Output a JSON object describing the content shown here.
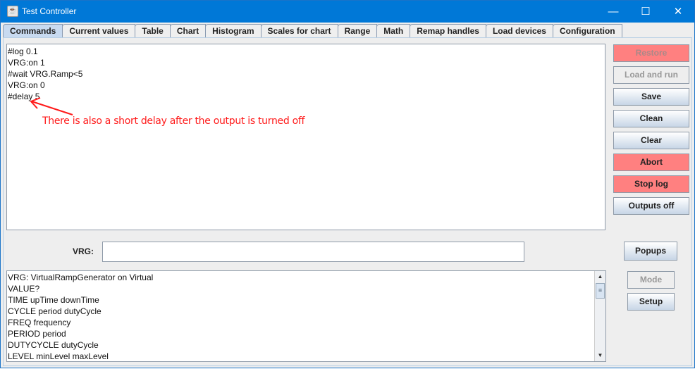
{
  "window": {
    "title": "Test Controller",
    "icon": "java-icon"
  },
  "tabs": [
    {
      "label": "Commands",
      "active": true
    },
    {
      "label": "Current values"
    },
    {
      "label": "Table"
    },
    {
      "label": "Chart"
    },
    {
      "label": "Histogram"
    },
    {
      "label": "Scales for chart"
    },
    {
      "label": "Range"
    },
    {
      "label": "Math"
    },
    {
      "label": "Remap handles"
    },
    {
      "label": "Load devices"
    },
    {
      "label": "Configuration"
    }
  ],
  "script_lines": [
    "#log 0.1",
    "VRG:on 1",
    "#wait VRG.Ramp<5",
    "VRG:on 0",
    "#delay 5"
  ],
  "annotation": {
    "text": "There is also a short delay after the output is turned off",
    "color": "#ff1a1a"
  },
  "buttons": {
    "restore": "Restore",
    "load_and_run": "Load and run",
    "save": "Save",
    "clean": "Clean",
    "clear": "Clear",
    "abort": "Abort",
    "stop_log": "Stop log",
    "outputs_off": "Outputs off",
    "popups": "Popups",
    "mode": "Mode",
    "setup": "Setup"
  },
  "device": {
    "label": "VRG:",
    "input_value": ""
  },
  "command_list": [
    "VRG: VirtualRampGenerator on Virtual",
    "VALUE?",
    "TIME upTime downTime",
    "CYCLE period dutyCycle",
    "FREQ frequency",
    "PERIOD period",
    "DUTYCYCLE dutyCycle",
    "LEVEL minLevel maxLevel"
  ],
  "colors": {
    "titlebar": "#0078d7",
    "alert_button": "#ff8080"
  }
}
